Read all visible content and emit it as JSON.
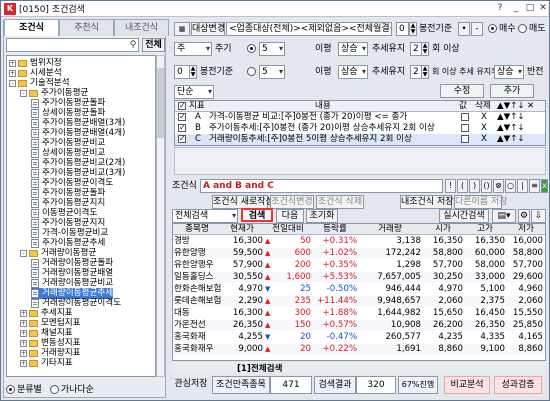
{
  "window": {
    "title": "[0150] 조건검색"
  },
  "tabs": [
    "조건식",
    "추천식",
    "내조건식"
  ],
  "search": {
    "button": "전체"
  },
  "tree": [
    {
      "t": "범위지정",
      "l": 0,
      "type": "folder",
      "exp": "+"
    },
    {
      "t": "시세분석",
      "l": 0,
      "type": "folder",
      "exp": "+"
    },
    {
      "t": "기술적분석",
      "l": 0,
      "type": "folder",
      "exp": "-"
    },
    {
      "t": "주가이동평균",
      "l": 1,
      "type": "folder",
      "exp": "-"
    },
    {
      "t": "주가이동평균돌파",
      "l": 2,
      "type": "doc"
    },
    {
      "t": "상세이동평균돌파",
      "l": 2,
      "type": "doc"
    },
    {
      "t": "주가이동평균배열(3개)",
      "l": 2,
      "type": "doc"
    },
    {
      "t": "주가이동평균배열(4개)",
      "l": 2,
      "type": "doc"
    },
    {
      "t": "주가이동평균비교",
      "l": 2,
      "type": "doc"
    },
    {
      "t": "상세이동평균비교",
      "l": 2,
      "type": "doc"
    },
    {
      "t": "주가이동평균비교(2개)",
      "l": 2,
      "type": "doc"
    },
    {
      "t": "주가이동평균비교(3개)",
      "l": 2,
      "type": "doc"
    },
    {
      "t": "주가이동평균이격도",
      "l": 2,
      "type": "doc"
    },
    {
      "t": "주가이동평균돌파",
      "l": 2,
      "type": "doc"
    },
    {
      "t": "주가이동평균지지",
      "l": 2,
      "type": "doc"
    },
    {
      "t": "이동평균이격도",
      "l": 2,
      "type": "doc"
    },
    {
      "t": "주가이동평균지지",
      "l": 2,
      "type": "doc"
    },
    {
      "t": "가격-이동평균비교",
      "l": 2,
      "type": "doc"
    },
    {
      "t": "주가이동평균추세",
      "l": 2,
      "type": "doc"
    },
    {
      "t": "거래량이동평균",
      "l": 1,
      "type": "folder",
      "exp": "-"
    },
    {
      "t": "거래량이동평균돌파",
      "l": 2,
      "type": "doc"
    },
    {
      "t": "거래량이동평균배열",
      "l": 2,
      "type": "doc"
    },
    {
      "t": "거래량이동평균비교",
      "l": 2,
      "type": "doc"
    },
    {
      "t": "거래량이동평균추세",
      "l": 2,
      "type": "doc",
      "sel": true
    },
    {
      "t": "거래량이동평균이격도",
      "l": 2,
      "type": "doc"
    },
    {
      "t": "추세지표",
      "l": 1,
      "type": "folder",
      "exp": "+"
    },
    {
      "t": "모멘텀지표",
      "l": 1,
      "type": "folder",
      "exp": "+"
    },
    {
      "t": "채널지표",
      "l": 1,
      "type": "folder",
      "exp": "+"
    },
    {
      "t": "변동성지표",
      "l": 1,
      "type": "folder",
      "exp": "+"
    },
    {
      "t": "거래량지표",
      "l": 1,
      "type": "folder",
      "exp": "+"
    },
    {
      "t": "기타지표",
      "l": 1,
      "type": "folder",
      "exp": "+"
    }
  ],
  "radio": {
    "opt1": "분류별",
    "opt2": "가나다순"
  },
  "top": {
    "target_btn": "대상변경",
    "target_text": "<업종대상(전체)><제외없음><전체월결산>",
    "spin_val": "0",
    "period": "봉전기준",
    "radio1": "매수",
    "radio2": "매도"
  },
  "params": {
    "freq": "주",
    "freq_lbl": "주기",
    "offset": "0",
    "offset_lbl": "봉전기준",
    "r1_val": "5",
    "r1_lbl": "이평",
    "r1_trend": "상승",
    "r1_sel": "추세유지",
    "r1_n": "2",
    "r1_ci": "회 이상",
    "r2_val": "5",
    "r2_lbl": "이평",
    "r2_trend": "상승",
    "r2_sel": "추세유지",
    "r2_n": "2",
    "r2_ci": "회 이상 추세 유지후",
    "r2_after": "상승",
    "r2_rev": "반전",
    "single": "단순",
    "edit": "수정",
    "add": "추가"
  },
  "cond_head": {
    "chk": "지표",
    "content": "내용",
    "val": "값",
    "del": "삭제"
  },
  "conds": [
    {
      "id": "A",
      "text": "가격-이동평균 비교:[주]0봉전 (종가 20)이평 <= 종가",
      "del": "X"
    },
    {
      "id": "B",
      "text": "주가이동추세:[주]0봉전 (종가 20)이평 상승추세유지 2회 이상",
      "del": "X"
    },
    {
      "id": "C",
      "text": "거래량이동추세:[주]0봉전 5이평 상승추세유지 2회 이상",
      "del": "X"
    }
  ],
  "expr": {
    "label": "조건식",
    "content": "A and B and C",
    "btns": [
      "조건식 새로작성",
      "조건식변경",
      "조건식 삭제",
      "내조건식 저장",
      "다른이름 저장"
    ]
  },
  "toolbar": {
    "scope": "전체검색",
    "search": "검색",
    "next": "다음",
    "reset": "초기화",
    "live": "실시간검색"
  },
  "grid_head": [
    "종목명",
    "현재가",
    "전일대비",
    "등락률",
    "거래량",
    "시가",
    "고가",
    "저가"
  ],
  "rows": [
    {
      "n": "경방",
      "p": "16,300",
      "c": "50",
      "r": "+0.31%",
      "v": "3,138",
      "o": "16,350",
      "h": "16,350",
      "l": "16,000",
      "u": true
    },
    {
      "n": "유한양행",
      "p": "59,500",
      "c": "600",
      "r": "+1.02%",
      "v": "172,242",
      "o": "58,800",
      "h": "60,000",
      "l": "58,800",
      "u": true
    },
    {
      "n": "유한양행우",
      "p": "57,900",
      "c": "200",
      "r": "+0.35%",
      "v": "1,298",
      "o": "57,700",
      "h": "58,000",
      "l": "57,700",
      "u": true
    },
    {
      "n": "일동홀딩스",
      "p": "30,550",
      "c": "1,600",
      "r": "+5.53%",
      "v": "7,657,005",
      "o": "30,250",
      "h": "33,000",
      "l": "29,600",
      "u": true
    },
    {
      "n": "한화손해보험",
      "p": "4,970",
      "c": "25",
      "r": "-0.50%",
      "v": "946,444",
      "o": "4,970",
      "h": "5,100",
      "l": "4,960",
      "u": false
    },
    {
      "n": "롯데손해보험",
      "p": "2,290",
      "c": "235",
      "r": "+11.44%",
      "v": "9,948,657",
      "o": "2,060",
      "h": "2,375",
      "l": "2,060",
      "u": true
    },
    {
      "n": "대동",
      "p": "16,300",
      "c": "300",
      "r": "+1.88%",
      "v": "1,644,982",
      "o": "15,650",
      "h": "16,450",
      "l": "15,550",
      "u": true
    },
    {
      "n": "가온전선",
      "p": "26,350",
      "c": "150",
      "r": "+0.57%",
      "v": "10,908",
      "o": "26,200",
      "h": "26,350",
      "l": "25,850",
      "u": true
    },
    {
      "n": "홍국화재",
      "p": "4,255",
      "c": "20",
      "r": "-0.47%",
      "v": "260,577",
      "o": "4,235",
      "h": "4,335",
      "l": "4,165",
      "u": false
    },
    {
      "n": "홍국화재우",
      "p": "9,000",
      "c": "20",
      "r": "+0.22%",
      "v": "1,691",
      "o": "8,860",
      "h": "9,100",
      "l": "8,860",
      "u": true
    }
  ],
  "result_tab": "[1]전체검색",
  "bottom": {
    "save": "관심저장",
    "found_lbl": "조건만족종목",
    "found": "471",
    "result_lbl": "검색결과",
    "result": "320",
    "progress": "67%진행",
    "compare": "비교분석",
    "verify": "성과검증"
  }
}
